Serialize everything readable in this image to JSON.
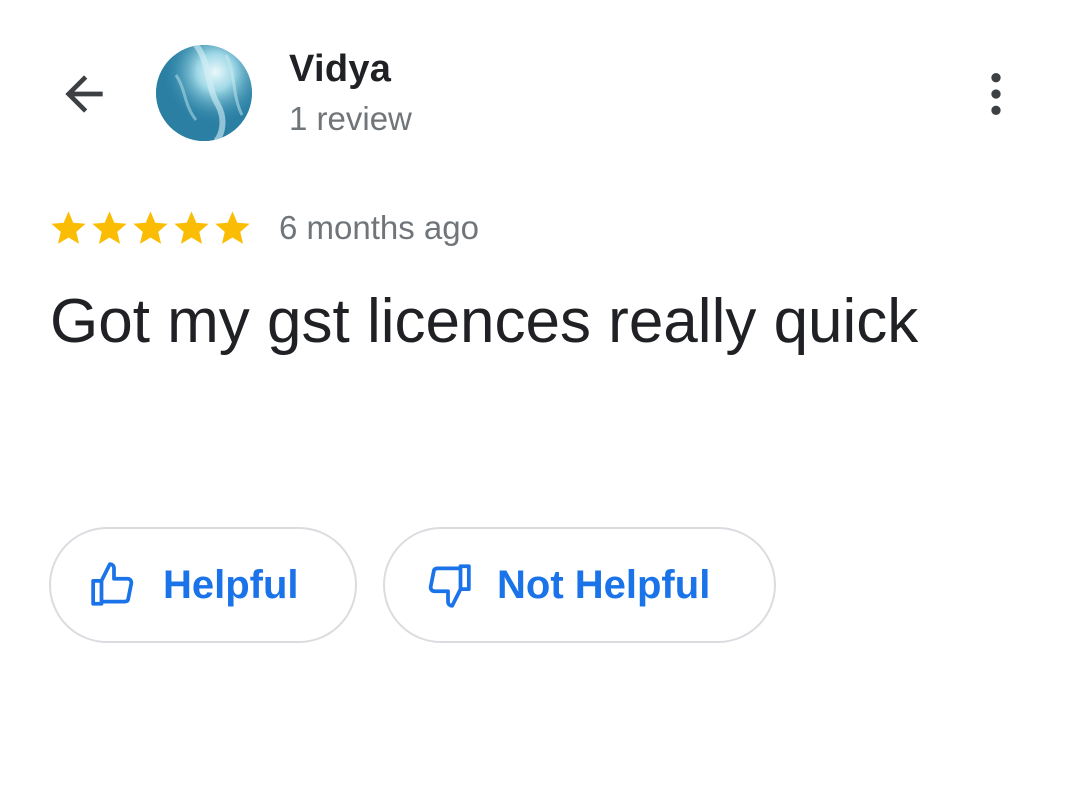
{
  "header": {
    "back_icon": "arrow-back-icon",
    "reviewer_name": "Vidya",
    "reviewer_subtitle": "1 review",
    "more_icon": "more-vert-icon"
  },
  "review": {
    "rating": 5,
    "rating_max": 5,
    "star_color": "#fbbc04",
    "time_ago": "6 months ago",
    "text": "Got my gst licences really quick"
  },
  "actions": {
    "helpful_label": "Helpful",
    "helpful_icon": "thumb-up-icon",
    "not_helpful_label": "Not Helpful",
    "not_helpful_icon": "thumb-down-icon",
    "accent_color": "#1a73e8"
  }
}
